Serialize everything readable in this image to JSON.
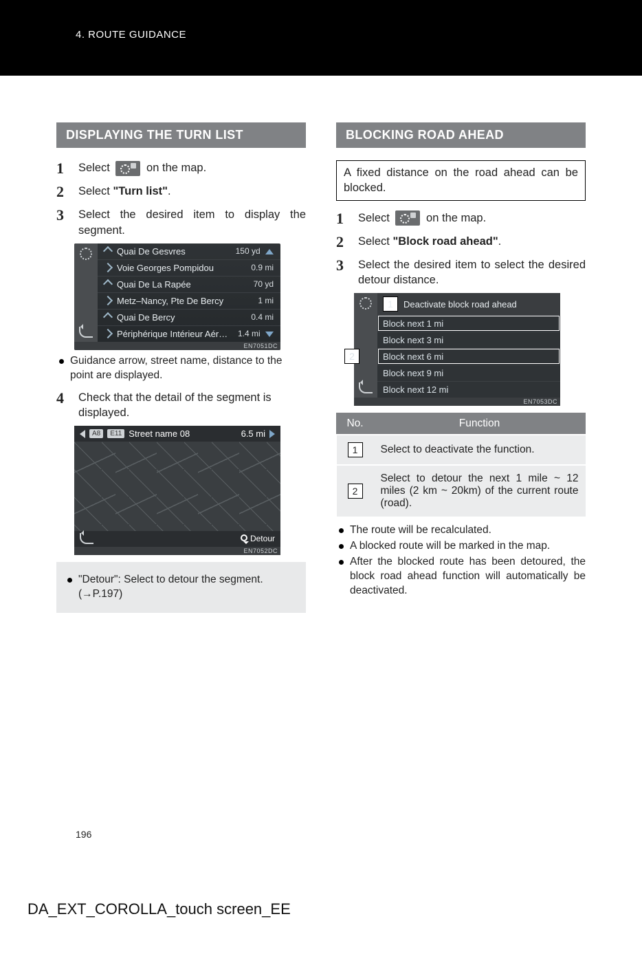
{
  "header": {
    "breadcrumb": "4. ROUTE GUIDANCE"
  },
  "left": {
    "section_title": "DISPLAYING THE TURN LIST",
    "steps": {
      "s1_a": "Select ",
      "s1_b": " on the map.",
      "s2_a": "Select ",
      "s2_bold": "\"Turn list\"",
      "s2_b": ".",
      "s3": "Select the desired item to display the segment.",
      "s4": "Check that the detail of the segment is displayed."
    },
    "turnlist": {
      "rows": [
        {
          "name": "Quai De Gesvres",
          "dist": "150 yd"
        },
        {
          "name": "Voie Georges Pompidou",
          "dist": "0.9 mi"
        },
        {
          "name": "Quai De La Rapée",
          "dist": "70 yd"
        },
        {
          "name": "Metz–Nancy, Pte De Bercy",
          "dist": "1 mi"
        },
        {
          "name": "Quai De Bercy",
          "dist": "0.4 mi"
        },
        {
          "name": "Périphérique Intérieur Aér…",
          "dist": "1.4 mi"
        }
      ],
      "code": "EN7051DC"
    },
    "bullet_after_turnlist": "Guidance arrow, street name, distance to the point are displayed.",
    "map": {
      "badge1": "A8",
      "badge2": "E11",
      "title": "Street name 08",
      "dist": "6.5 mi",
      "detour": "Detour",
      "code": "EN7052DC"
    },
    "note": {
      "bold": "\"Detour\"",
      "rest": ": Select to detour the segment. (→P.197)"
    }
  },
  "right": {
    "section_title": "BLOCKING ROAD AHEAD",
    "callout": "A fixed distance on the road ahead can be blocked.",
    "steps": {
      "s1_a": "Select ",
      "s1_b": " on the map.",
      "s2_a": "Select ",
      "s2_bold": "\"Block road ahead\"",
      "s2_b": ".",
      "s3": "Select the desired item to select the desired detour distance."
    },
    "blocklist": {
      "top": "Deactivate block road ahead",
      "rows": [
        "Block next 1 mi",
        "Block next 3 mi",
        "Block next 6 mi",
        "Block next 9 mi",
        "Block next 12 mi"
      ],
      "code": "EN7053DC",
      "num1": "1",
      "num2": "2"
    },
    "table": {
      "head_no": "No.",
      "head_fn": "Function",
      "r1_no": "1",
      "r1_fn": "Select to deactivate the function.",
      "r2_no": "2",
      "r2_fn": "Select to detour the next 1 mile ~ 12 miles (2 km ~ 20km) of the current route (road)."
    },
    "bullets": [
      "The route will be recalculated.",
      "A blocked route will be marked in the map.",
      "After the blocked route has been detoured, the block road ahead function will automatically be deactivated."
    ]
  },
  "footer": {
    "page": "196",
    "doc": "DA_EXT_COROLLA_touch screen_EE"
  }
}
